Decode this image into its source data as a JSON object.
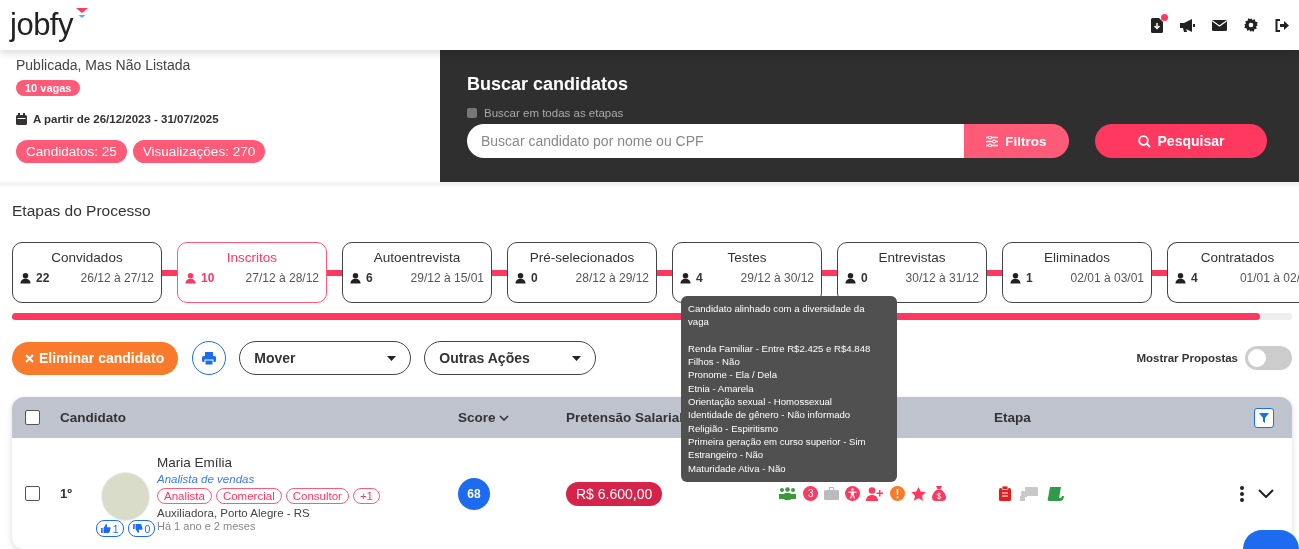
{
  "header": {
    "logo": "jobfy",
    "has_notification": true
  },
  "job": {
    "status": "Publicada, Mas Não Listada",
    "openings": "10 vagas",
    "period": "A partir de 26/12/2023 - 31/07/2025",
    "badges": [
      "Candidatos: 25",
      "Visualizações: 270"
    ]
  },
  "search": {
    "title": "Buscar candidatos",
    "all_stages": {
      "label": "Buscar em todas as etapas",
      "checked": false
    },
    "placeholder": "Buscar candidato por nome ou CPF",
    "filters_button": "Filtros",
    "search_button": "Pesquisar"
  },
  "stages": {
    "title": "Etapas do Processo",
    "items": [
      {
        "name": "Convidados",
        "count": "22",
        "dates": "26/12 à 27/12",
        "selected": false
      },
      {
        "name": "Inscritos",
        "count": "10",
        "dates": "27/12 à 28/12",
        "selected": true
      },
      {
        "name": "Autoentrevista",
        "count": "6",
        "dates": "29/12 à 15/01",
        "selected": false
      },
      {
        "name": "Pré-selecionados",
        "count": "0",
        "dates": "28/12 à 29/12",
        "selected": false
      },
      {
        "name": "Testes",
        "count": "4",
        "dates": "29/12 à 30/12",
        "selected": false
      },
      {
        "name": "Entrevistas",
        "count": "0",
        "dates": "30/12 à 31/12",
        "selected": false
      },
      {
        "name": "Eliminados",
        "count": "1",
        "dates": "02/01 à 03/01",
        "selected": false
      },
      {
        "name": "Contratados",
        "count": "4",
        "dates": "01/01 à 02/",
        "selected": false
      }
    ],
    "progress": {
      "level": 0.975
    }
  },
  "actions": {
    "eliminate": "Eliminar candidato",
    "move": "Mover",
    "other": "Outras Ações",
    "show_proposals": {
      "label": "Mostrar Propostas",
      "on": false
    }
  },
  "table": {
    "all_checked": false,
    "columns": [
      "Candidato",
      "Score",
      "Pretensão Salarial",
      "Etapa"
    ],
    "rows": [
      {
        "checked": false,
        "rank": "1º",
        "name": "Maria Emília",
        "role": "Analista de vendas",
        "tags": [
          "Analista",
          "Comercial",
          "Consultor",
          "+1"
        ],
        "location": "Auxiliadora, Porto Alegre - RS",
        "time": "Há 1 ano e 2 meses",
        "likes": "1",
        "dislikes": "0",
        "score": "68",
        "salary": "R$ 6.600,00",
        "alerts": "3"
      }
    ]
  },
  "tooltip": {
    "heading": "Candidato alinhado com a diversidade da vaga",
    "lines": [
      "Renda Familiar - Entre R$2.425 e R$4.848",
      "Filhos - Não",
      "Pronome - Ela / Dela",
      "Etnia - Amarela",
      "Orientação sexual - Homossexual",
      "Identidade de gênero - Não informado",
      "Religião - Espiritismo",
      "Primeira geração em curso superior - Sim",
      "Estrangeiro - Não",
      "Maturidade Ativa - Não"
    ]
  }
}
